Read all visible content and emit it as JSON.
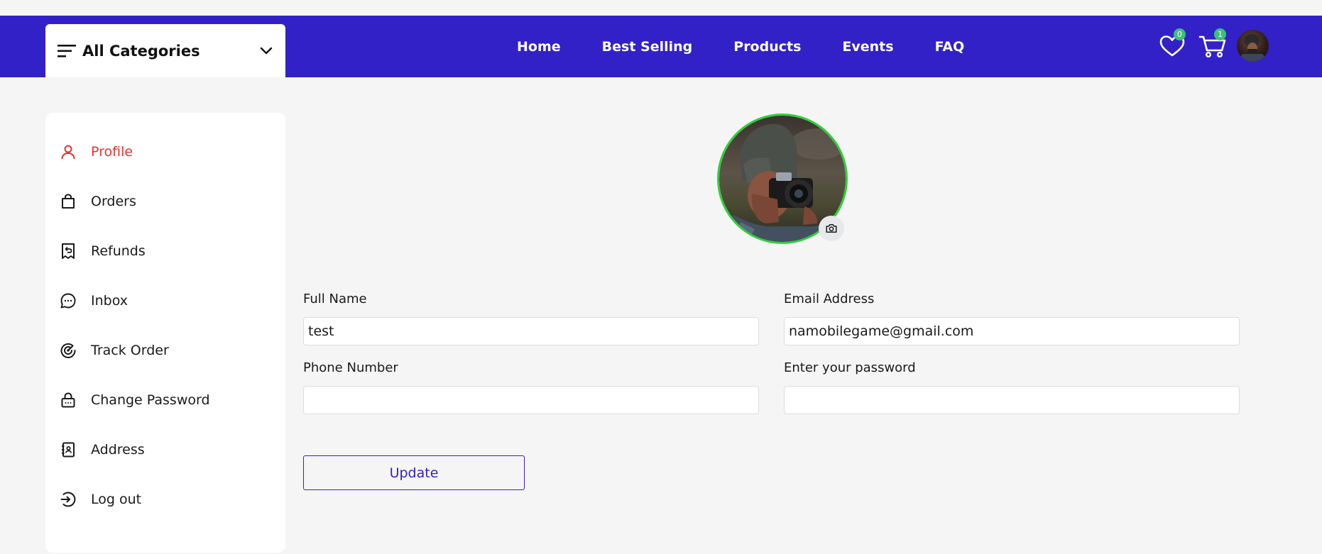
{
  "header": {
    "categories_label": "All Categories",
    "nav": [
      "Home",
      "Best Selling",
      "Products",
      "Events",
      "FAQ"
    ],
    "wishlist_count": "0",
    "cart_count": "1"
  },
  "sidebar": {
    "items": [
      {
        "label": "Profile",
        "icon": "user-icon",
        "active": true
      },
      {
        "label": "Orders",
        "icon": "shopping-bag-icon"
      },
      {
        "label": "Refunds",
        "icon": "receipt-refund-icon"
      },
      {
        "label": "Inbox",
        "icon": "chat-bubble-icon"
      },
      {
        "label": "Track Order",
        "icon": "radar-icon"
      },
      {
        "label": "Change Password",
        "icon": "lock-icon"
      },
      {
        "label": "Address",
        "icon": "address-book-icon"
      },
      {
        "label": "Log out",
        "icon": "logout-icon"
      }
    ]
  },
  "form": {
    "full_name_label": "Full Name",
    "full_name_value": "test",
    "email_label": "Email Address",
    "email_value": "namobilegame@gmail.com",
    "phone_label": "Phone Number",
    "phone_value": "",
    "password_label": "Enter your password",
    "password_value": "",
    "update_label": "Update"
  },
  "colors": {
    "navbar": "#3321c8",
    "active_item": "#e3342f",
    "avatar_border": "#2fd03a",
    "badge": "#3bc177",
    "background": "#f5f5f5"
  }
}
